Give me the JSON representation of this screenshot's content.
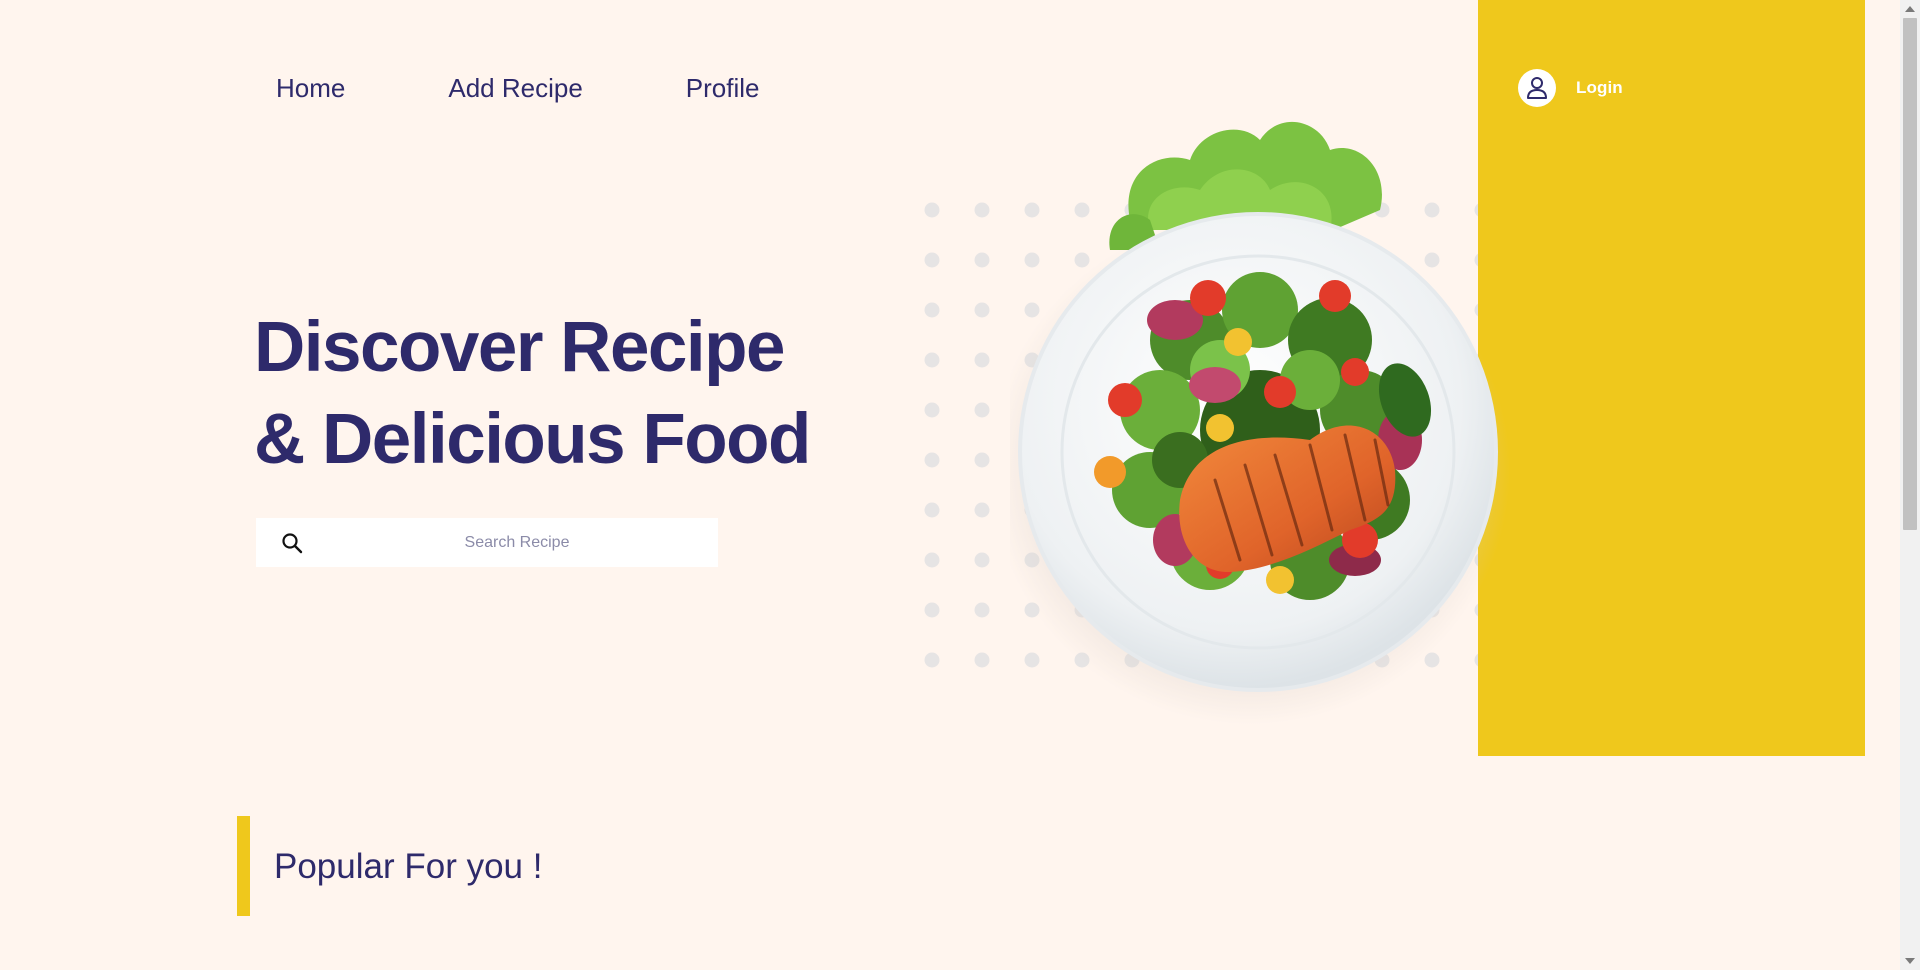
{
  "nav": {
    "items": [
      {
        "label": "Home"
      },
      {
        "label": "Add Recipe"
      },
      {
        "label": "Profile"
      }
    ]
  },
  "header": {
    "login_label": "Login",
    "avatar_icon": "user-icon",
    "accent_color": "#EFC81C"
  },
  "hero": {
    "title_line1": "Discover Recipe",
    "title_line2": "& Delicious Food",
    "image_icon": "salmon-salad-plate-image"
  },
  "search": {
    "placeholder": "Search Recipe",
    "value": "",
    "icon": "search-icon"
  },
  "popular": {
    "title": "Popular For you !"
  },
  "colors": {
    "background": "#FFF5EE",
    "primary_text": "#2E2A6B",
    "accent": "#EFC81C"
  }
}
